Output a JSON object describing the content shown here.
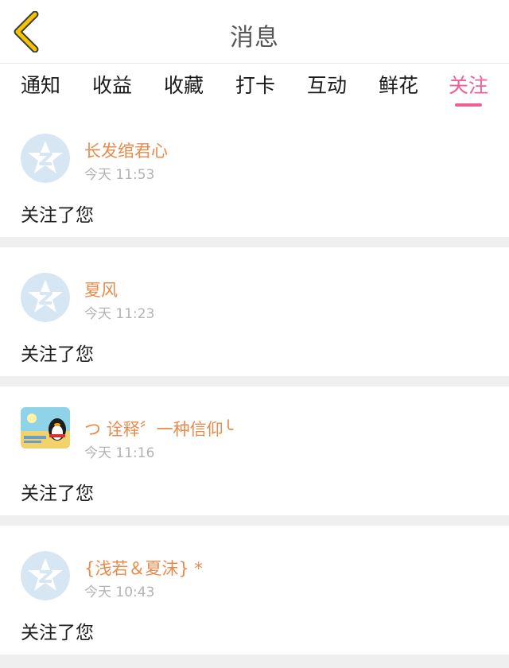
{
  "header": {
    "title": "消息",
    "back_icon": "chevron-left-icon"
  },
  "colors": {
    "accent_pink": "#ef5f98",
    "username_orange": "#e88a4c",
    "back_yellow": "#f5c400"
  },
  "tabs": [
    {
      "label": "通知",
      "active": false
    },
    {
      "label": "收益",
      "active": false
    },
    {
      "label": "收藏",
      "active": false
    },
    {
      "label": "打卡",
      "active": false
    },
    {
      "label": "互动",
      "active": false
    },
    {
      "label": "鲜花",
      "active": false
    },
    {
      "label": "关注",
      "active": true
    }
  ],
  "notifications": [
    {
      "user": "长发绾君心",
      "time": "今天 11:53",
      "action": "关注了您",
      "avatar": "qzone-star-avatar"
    },
    {
      "user": "夏风",
      "time": "今天 11:23",
      "action": "关注了您",
      "avatar": "qzone-star-avatar"
    },
    {
      "user": "つ 诠释〞一种信仰╰",
      "time": "今天 11:16",
      "action": "关注了您",
      "avatar": "penguin-photo-avatar"
    },
    {
      "user": "{浅若＆夏沫} *",
      "time": "今天 10:43",
      "action": "关注了您",
      "avatar": "qzone-star-avatar"
    }
  ]
}
